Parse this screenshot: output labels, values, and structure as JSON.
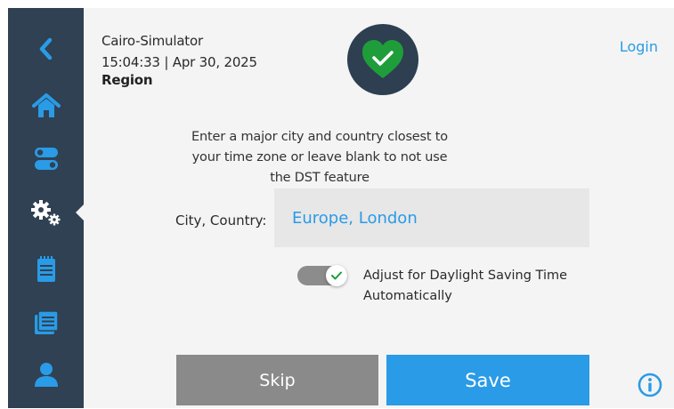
{
  "header": {
    "device_name": "Cairo-Simulator",
    "datetime": "15:04:33 | Apr 30, 2025",
    "page_title": "Region",
    "login_label": "Login",
    "status_icon": "heart-check-icon"
  },
  "sidebar": {
    "items": [
      {
        "name": "back",
        "icon": "chevron-left-icon"
      },
      {
        "name": "home",
        "icon": "home-icon"
      },
      {
        "name": "toggles",
        "icon": "toggle-switches-icon"
      },
      {
        "name": "settings",
        "icon": "gears-icon",
        "active": true
      },
      {
        "name": "notes",
        "icon": "notepad-icon"
      },
      {
        "name": "logs",
        "icon": "files-icon"
      },
      {
        "name": "user",
        "icon": "user-icon"
      }
    ]
  },
  "main": {
    "instructions": "Enter a major city and country closest to your time zone or leave blank to not use the DST feature",
    "city_label": "City, Country:",
    "city_value": "Europe, London",
    "dst_label": "Adjust for Daylight Saving Time Automatically",
    "dst_enabled": true,
    "skip_label": "Skip",
    "save_label": "Save",
    "info_icon": "info-icon"
  },
  "colors": {
    "sidebar": "#2f4153",
    "accent": "#2a9be6",
    "badge": "#2d3f50",
    "heart": "#1f9d3a",
    "skip": "#8a8a8a",
    "panel": "#f4f4f4"
  }
}
